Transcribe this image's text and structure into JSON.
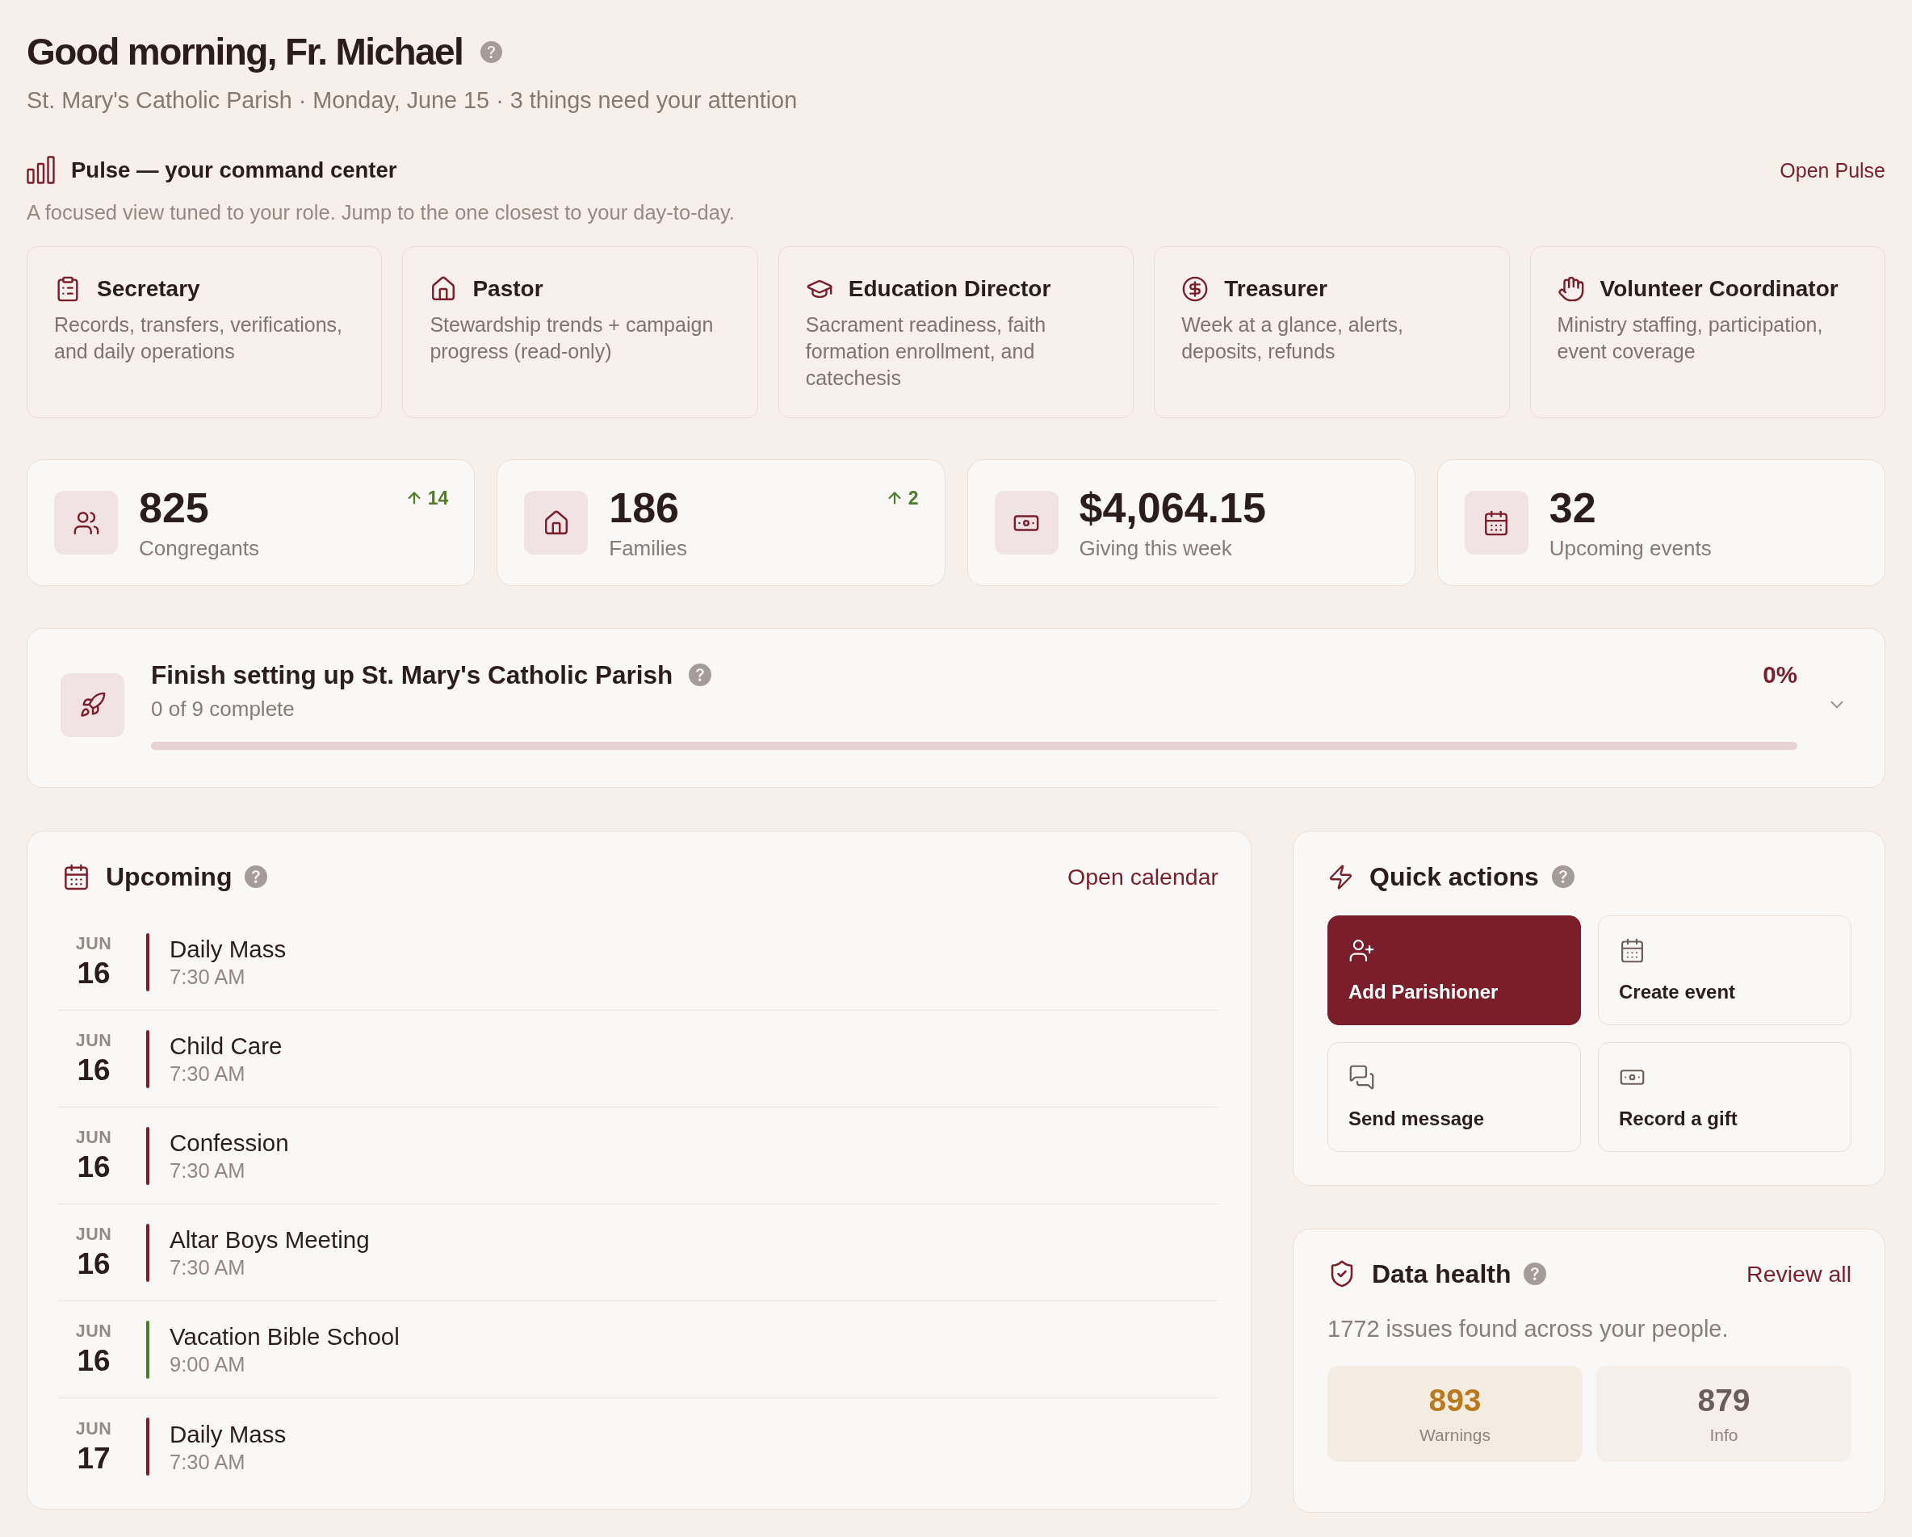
{
  "header": {
    "title": "Good morning, Fr. Michael",
    "subtitle": "St. Mary's Catholic Parish · Monday, June 15 · 3 things need your attention"
  },
  "pulse": {
    "title": "Pulse — your command center",
    "link": "Open Pulse",
    "description": "A focused view tuned to your role. Jump to the one closest to your day-to-day.",
    "roles": [
      {
        "title": "Secretary",
        "description": "Records, transfers, verifications, and daily operations"
      },
      {
        "title": "Pastor",
        "description": "Stewardship trends + campaign progress (read-only)"
      },
      {
        "title": "Education Director",
        "description": "Sacrament readiness, faith formation enrollment, and catechesis"
      },
      {
        "title": "Treasurer",
        "description": "Week at a glance, alerts, deposits, refunds"
      },
      {
        "title": "Volunteer Coordinator",
        "description": "Ministry staffing, participation, event coverage"
      }
    ]
  },
  "stats": [
    {
      "value": "825",
      "label": "Congregants",
      "delta": "14"
    },
    {
      "value": "186",
      "label": "Families",
      "delta": "2"
    },
    {
      "value": "$4,064.15",
      "label": "Giving this week"
    },
    {
      "value": "32",
      "label": "Upcoming events"
    }
  ],
  "setup": {
    "title": "Finish setting up St. Mary's Catholic Parish",
    "progress_text": "0 of 9 complete",
    "percent": "0%",
    "level": 0,
    "expanded": false
  },
  "upcoming": {
    "title": "Upcoming",
    "link": "Open calendar",
    "events": [
      {
        "month": "JUN",
        "day": "16",
        "title": "Daily Mass",
        "time": "7:30 AM",
        "color": "#7b1e2b"
      },
      {
        "month": "JUN",
        "day": "16",
        "title": "Child Care",
        "time": "7:30 AM",
        "color": "#7b1e2b"
      },
      {
        "month": "JUN",
        "day": "16",
        "title": "Confession",
        "time": "7:30 AM",
        "color": "#7b1e2b"
      },
      {
        "month": "JUN",
        "day": "16",
        "title": "Altar Boys Meeting",
        "time": "7:30 AM",
        "color": "#7b1e2b"
      },
      {
        "month": "JUN",
        "day": "16",
        "title": "Vacation Bible School",
        "time": "9:00 AM",
        "color": "#4f7d2c"
      },
      {
        "month": "JUN",
        "day": "17",
        "title": "Daily Mass",
        "time": "7:30 AM",
        "color": "#7b1e2b"
      }
    ]
  },
  "quick_actions": {
    "title": "Quick actions",
    "actions": [
      {
        "label": "Add Parishioner",
        "kind": "primary"
      },
      {
        "label": "Create event",
        "kind": "default"
      },
      {
        "label": "Send message",
        "kind": "default"
      },
      {
        "label": "Record a gift",
        "kind": "default"
      }
    ]
  },
  "data_health": {
    "title": "Data health",
    "link": "Review all",
    "summary": "1772 issues found across your people.",
    "counts": [
      {
        "value": "893",
        "label": "Warnings",
        "kind": "warning"
      },
      {
        "value": "879",
        "label": "Info",
        "kind": "info"
      }
    ]
  }
}
